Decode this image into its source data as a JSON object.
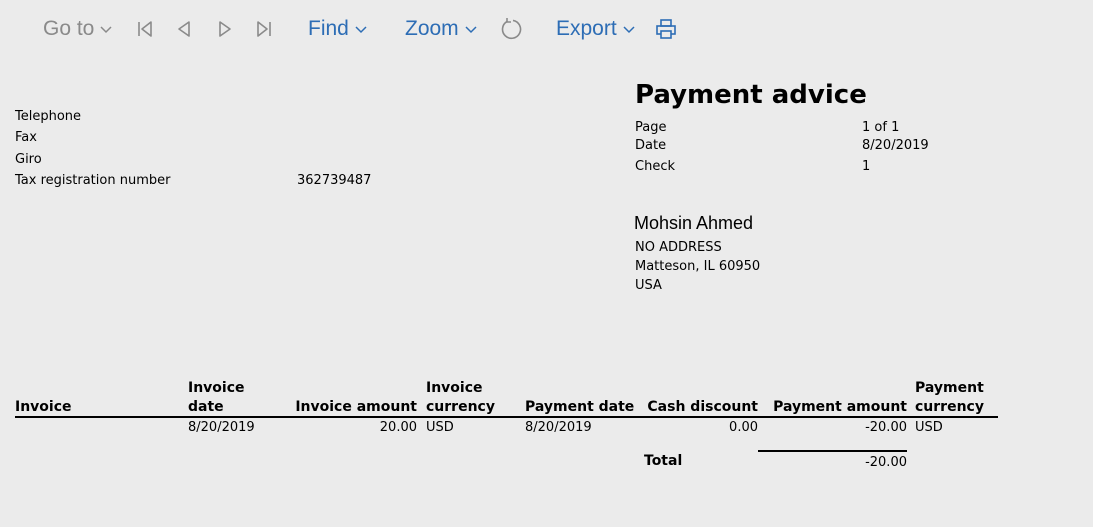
{
  "toolbar": {
    "goto_label": "Go to",
    "find_label": "Find",
    "zoom_label": "Zoom",
    "export_label": "Export",
    "icons": [
      "chevron-down-icon",
      "first-page-icon",
      "previous-page-icon",
      "next-page-icon",
      "last-page-icon",
      "refresh-icon",
      "print-icon"
    ],
    "colors": {
      "enabled": "#2d6db5",
      "disabled": "#8a8a8a"
    }
  },
  "company_info": {
    "telephone_label": "Telephone",
    "fax_label": "Fax",
    "giro_label": "Giro",
    "tax_label": "Tax registration number",
    "tax_value": "362739487"
  },
  "doc": {
    "title": "Payment advice",
    "page_label": "Page",
    "page_value": "1 of 1",
    "date_label": "Date",
    "date_value": "8/20/2019",
    "check_label": "Check",
    "check_value": "1"
  },
  "payee": {
    "name": "Mohsin Ahmed",
    "address_line1": "NO ADDRESS",
    "address_line2": "Matteson, IL 60950",
    "address_line3": "USA"
  },
  "table": {
    "headers": {
      "invoice": "Invoice",
      "invoice_date_1": "Invoice",
      "invoice_date_2": "date",
      "invoice_amount": "Invoice amount",
      "invoice_currency_1": "Invoice",
      "invoice_currency_2": "currency",
      "payment_date": "Payment date",
      "cash_discount": "Cash discount",
      "payment_amount": "Payment amount",
      "payment_currency_1": "Payment",
      "payment_currency_2": "currency"
    },
    "rows": [
      {
        "invoice": "",
        "invoice_date": "8/20/2019",
        "invoice_amount": "20.00",
        "invoice_currency": "USD",
        "payment_date": "8/20/2019",
        "cash_discount": "0.00",
        "payment_amount": "-20.00",
        "payment_currency": "USD"
      }
    ],
    "total_label": "Total",
    "total_value": "-20.00"
  }
}
